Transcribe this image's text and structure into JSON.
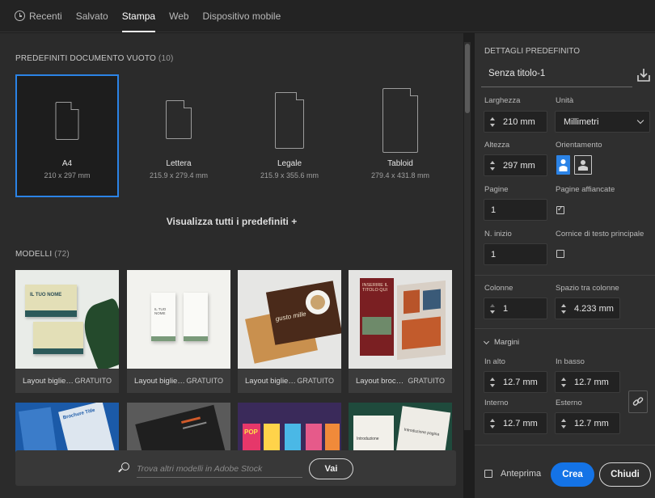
{
  "nav": {
    "tabs": [
      "Recenti",
      "Salvato",
      "Stampa",
      "Web",
      "Dispositivo mobile"
    ],
    "active": "Stampa"
  },
  "blank_presets": {
    "title": "PREDEFINITI DOCUMENTO VUOTO",
    "count": "(10)",
    "items": [
      {
        "name": "A4",
        "size": "210 x 297 mm"
      },
      {
        "name": "Lettera",
        "size": "215.9 x 279.4 mm"
      },
      {
        "name": "Legale",
        "size": "215.9 x 355.6 mm"
      },
      {
        "name": "Tabloid",
        "size": "279.4 x 431.8 mm"
      }
    ],
    "see_all": "Visualizza tutti i predefiniti +"
  },
  "templates": {
    "title": "MODELLI",
    "count": "(72)",
    "items": [
      {
        "name": "Layout bigliett...",
        "badge": "GRATUITO",
        "thumb_text": "IL TUO NOME"
      },
      {
        "name": "Layout bigliett...",
        "badge": "GRATUITO",
        "thumb_text": "IL TUO NOME"
      },
      {
        "name": "Layout bigliett...",
        "badge": "GRATUITO",
        "thumb_text": "gusto mille"
      },
      {
        "name": "Layout brochur...",
        "badge": "GRATUITO",
        "thumb_text": "INSERIRE IL TITOLO QUI"
      }
    ],
    "row2_thumb_texts": [
      "Brochure Title",
      "",
      "POP",
      "Introduzione pagina"
    ]
  },
  "search": {
    "placeholder": "Trova altri modelli in Adobe Stock",
    "go_label": "Vai"
  },
  "details": {
    "header": "DETTAGLI PREDEFINITO",
    "doc_name": "Senza titolo-1",
    "width_label": "Larghezza",
    "width_value": "210 mm",
    "units_label": "Unità",
    "units_value": "Millimetri",
    "height_label": "Altezza",
    "height_value": "297 mm",
    "orientation_label": "Orientamento",
    "pages_label": "Pagine",
    "pages_value": "1",
    "facing_label": "Pagine affiancate",
    "facing_checked": true,
    "start_label": "N. inizio",
    "start_value": "1",
    "primary_frame_label": "Cornice di testo principale",
    "primary_frame_checked": false,
    "columns_label": "Colonne",
    "columns_value": "1",
    "gutter_label": "Spazio tra colonne",
    "gutter_value": "4.233 mm",
    "margins_label": "Margini",
    "top_label": "In alto",
    "top_value": "12.7 mm",
    "bottom_label": "In basso",
    "bottom_value": "12.7 mm",
    "inside_label": "Interno",
    "inside_value": "12.7 mm",
    "outside_label": "Esterno",
    "outside_value": "12.7 mm",
    "preview_label": "Anteprima",
    "create_label": "Crea",
    "close_label": "Chiudi"
  },
  "colors": {
    "accent": "#2b83e6",
    "panel_bg": "#2f2f2f",
    "main_bg": "#2b2b2b"
  }
}
